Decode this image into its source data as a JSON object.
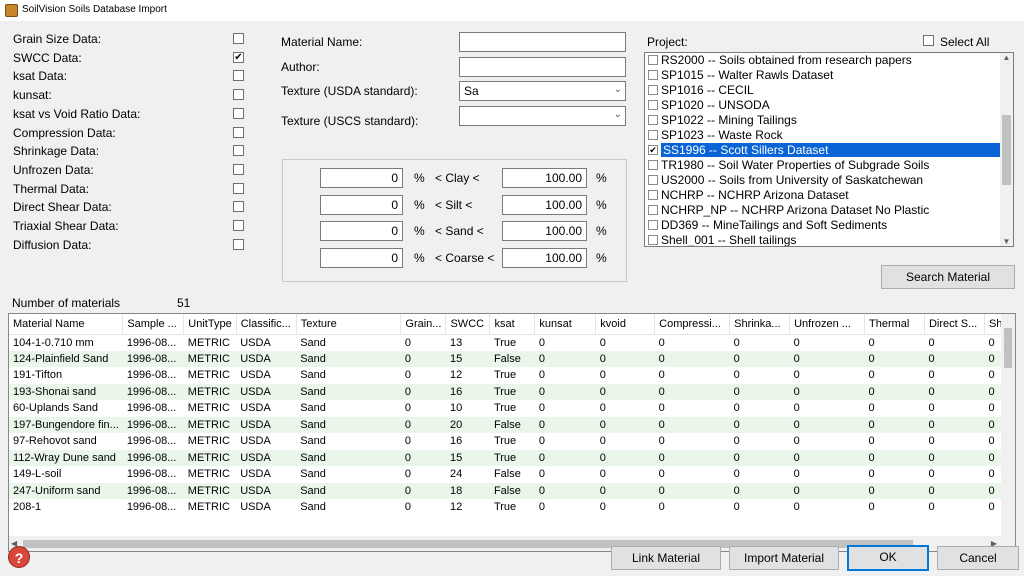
{
  "window": {
    "title": "SoilVision Soils Database Import"
  },
  "data_types": [
    {
      "label": "Grain Size Data:",
      "checked": false
    },
    {
      "label": "SWCC Data:",
      "checked": true
    },
    {
      "label": "ksat Data:",
      "checked": false
    },
    {
      "label": "kunsat:",
      "checked": false
    },
    {
      "label": "ksat vs Void Ratio Data:",
      "checked": false
    },
    {
      "label": "Compression Data:",
      "checked": false
    },
    {
      "label": "Shrinkage Data:",
      "checked": false
    },
    {
      "label": "Unfrozen Data:",
      "checked": false
    },
    {
      "label": "Thermal Data:",
      "checked": false
    },
    {
      "label": "Direct Shear Data:",
      "checked": false
    },
    {
      "label": "Triaxial Shear Data:",
      "checked": false
    },
    {
      "label": "Diffusion Data:",
      "checked": false
    }
  ],
  "fields": {
    "material_name_label": "Material Name:",
    "material_name_value": "",
    "author_label": "Author:",
    "author_value": "",
    "texture_usda_label": "Texture (USDA standard):",
    "texture_usda_value": "Sa",
    "texture_uscs_label": "Texture (USCS standard):",
    "texture_uscs_value": ""
  },
  "ranges": [
    {
      "min": "0",
      "unit1": "%",
      "label": "< Clay <",
      "max": "100.00",
      "unit2": "%"
    },
    {
      "min": "0",
      "unit1": "%",
      "label": "< Silt <",
      "max": "100.00",
      "unit2": "%"
    },
    {
      "min": "0",
      "unit1": "%",
      "label": "< Sand <",
      "max": "100.00",
      "unit2": "%"
    },
    {
      "min": "0",
      "unit1": "%",
      "label": "< Coarse <",
      "max": "100.00",
      "unit2": "%"
    }
  ],
  "project": {
    "label": "Project:",
    "select_all_label": "Select All",
    "select_all_checked": false,
    "items": [
      {
        "text": "RS2000 -- Soils obtained from research papers",
        "checked": false,
        "selected": false
      },
      {
        "text": "SP1015 -- Walter Rawls Dataset",
        "checked": false,
        "selected": false
      },
      {
        "text": "SP1016 -- CECIL",
        "checked": false,
        "selected": false
      },
      {
        "text": "SP1020 -- UNSODA",
        "checked": false,
        "selected": false
      },
      {
        "text": "SP1022 -- Mining Tailings",
        "checked": false,
        "selected": false
      },
      {
        "text": "SP1023 -- Waste Rock",
        "checked": false,
        "selected": false
      },
      {
        "text": "SS1996 -- Scott Sillers Dataset",
        "checked": true,
        "selected": true
      },
      {
        "text": "TR1980 -- Soil Water Properties of Subgrade Soils",
        "checked": false,
        "selected": false
      },
      {
        "text": "US2000 -- Soils from University of Saskatchewan",
        "checked": false,
        "selected": false
      },
      {
        "text": "NCHRP -- NCHRP Arizona Dataset",
        "checked": false,
        "selected": false
      },
      {
        "text": "NCHRP_NP -- NCHRP Arizona Dataset No Plastic",
        "checked": false,
        "selected": false
      },
      {
        "text": "DD369 -- MineTailings and Soft Sediments",
        "checked": false,
        "selected": false
      },
      {
        "text": "Shell_001 -- Shell tailings",
        "checked": false,
        "selected": false
      }
    ]
  },
  "search_button": "Search Material",
  "count": {
    "label": "Number of materials",
    "value": "51"
  },
  "table": {
    "columns": [
      "Material Name",
      "Sample ...",
      "UnitType",
      "Classific...",
      "Texture",
      "Grain...",
      "SWCC",
      "ksat",
      "kunsat",
      "kvoid",
      "Compressi...",
      "Shrinka...",
      "Unfrozen ...",
      "Thermal",
      "Direct S...",
      "Sh"
    ],
    "rows": [
      [
        "104-1-0.710 mm",
        "1996-08...",
        "METRIC",
        "USDA",
        "Sand",
        "0",
        "13",
        "True",
        "0",
        "0",
        "0",
        "0",
        "0",
        "0",
        "0",
        "0"
      ],
      [
        "124-Plainfield Sand",
        "1996-08...",
        "METRIC",
        "USDA",
        "Sand",
        "0",
        "15",
        "False",
        "0",
        "0",
        "0",
        "0",
        "0",
        "0",
        "0",
        "0"
      ],
      [
        "191-Tifton",
        "1996-08...",
        "METRIC",
        "USDA",
        "Sand",
        "0",
        "12",
        "True",
        "0",
        "0",
        "0",
        "0",
        "0",
        "0",
        "0",
        "0"
      ],
      [
        "193-Shonai sand",
        "1996-08...",
        "METRIC",
        "USDA",
        "Sand",
        "0",
        "16",
        "True",
        "0",
        "0",
        "0",
        "0",
        "0",
        "0",
        "0",
        "0"
      ],
      [
        "60-Uplands Sand",
        "1996-08...",
        "METRIC",
        "USDA",
        "Sand",
        "0",
        "10",
        "True",
        "0",
        "0",
        "0",
        "0",
        "0",
        "0",
        "0",
        "0"
      ],
      [
        "197-Bungendore fin...",
        "1996-08...",
        "METRIC",
        "USDA",
        "Sand",
        "0",
        "20",
        "False",
        "0",
        "0",
        "0",
        "0",
        "0",
        "0",
        "0",
        "0"
      ],
      [
        "97-Rehovot sand",
        "1996-08...",
        "METRIC",
        "USDA",
        "Sand",
        "0",
        "16",
        "True",
        "0",
        "0",
        "0",
        "0",
        "0",
        "0",
        "0",
        "0"
      ],
      [
        "112-Wray Dune sand",
        "1996-08...",
        "METRIC",
        "USDA",
        "Sand",
        "0",
        "15",
        "True",
        "0",
        "0",
        "0",
        "0",
        "0",
        "0",
        "0",
        "0"
      ],
      [
        "149-L-soil",
        "1996-08...",
        "METRIC",
        "USDA",
        "Sand",
        "0",
        "24",
        "False",
        "0",
        "0",
        "0",
        "0",
        "0",
        "0",
        "0",
        "0"
      ],
      [
        "247-Uniform sand",
        "1996-08...",
        "METRIC",
        "USDA",
        "Sand",
        "0",
        "18",
        "False",
        "0",
        "0",
        "0",
        "0",
        "0",
        "0",
        "0",
        "0"
      ],
      [
        "208-1",
        "1996-08...",
        "METRIC",
        "USDA",
        "Sand",
        "0",
        "12",
        "True",
        "0",
        "0",
        "0",
        "0",
        "0",
        "0",
        "0",
        "0"
      ]
    ]
  },
  "buttons": {
    "link": "Link Material",
    "import": "Import Material",
    "ok": "OK",
    "cancel": "Cancel"
  },
  "icons": {
    "help": "?",
    "check": "✔"
  }
}
